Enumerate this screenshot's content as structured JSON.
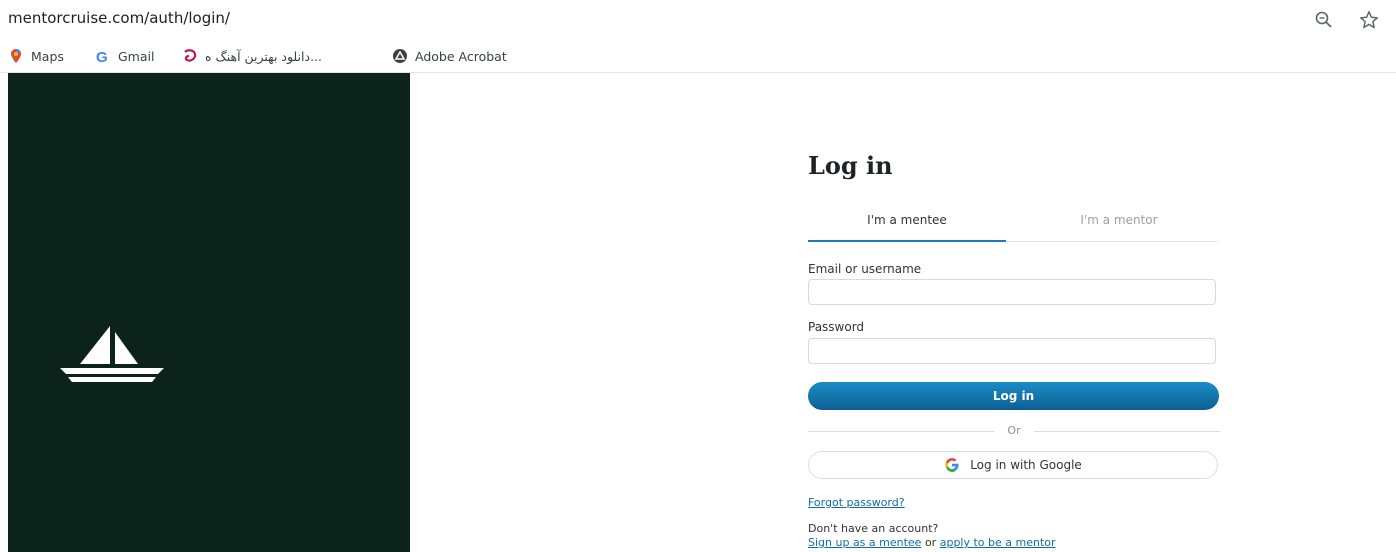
{
  "browser": {
    "url": "mentorcruise.com/auth/login/"
  },
  "bookmarks": [
    {
      "label": "Maps",
      "icon": "maps-icon"
    },
    {
      "label": "Gmail",
      "icon": "google-icon"
    },
    {
      "label": "دانلود بهترین آهنگ ه...",
      "icon": "music-site-icon"
    },
    {
      "label": "Adobe Acrobat",
      "icon": "acrobat-icon"
    }
  ],
  "login": {
    "title": "Log in",
    "tabs": {
      "mentee": "I'm a mentee",
      "mentor": "I'm a mentor"
    },
    "email_label": "Email or username",
    "email_value": "",
    "password_label": "Password",
    "password_value": "",
    "submit_label": "Log in",
    "or_text": "Or",
    "google_label": "Log in with Google",
    "forgot_label": "Forgot password?",
    "no_account_text": "Don't have an account?",
    "signup_mentee_label": "Sign up as a mentee",
    "or_word": "or",
    "apply_mentor_label": "apply to be a mentor"
  },
  "colors": {
    "left_panel": "#0b231b",
    "accent": "#1c7ab8",
    "button": "#1b8cc6"
  }
}
